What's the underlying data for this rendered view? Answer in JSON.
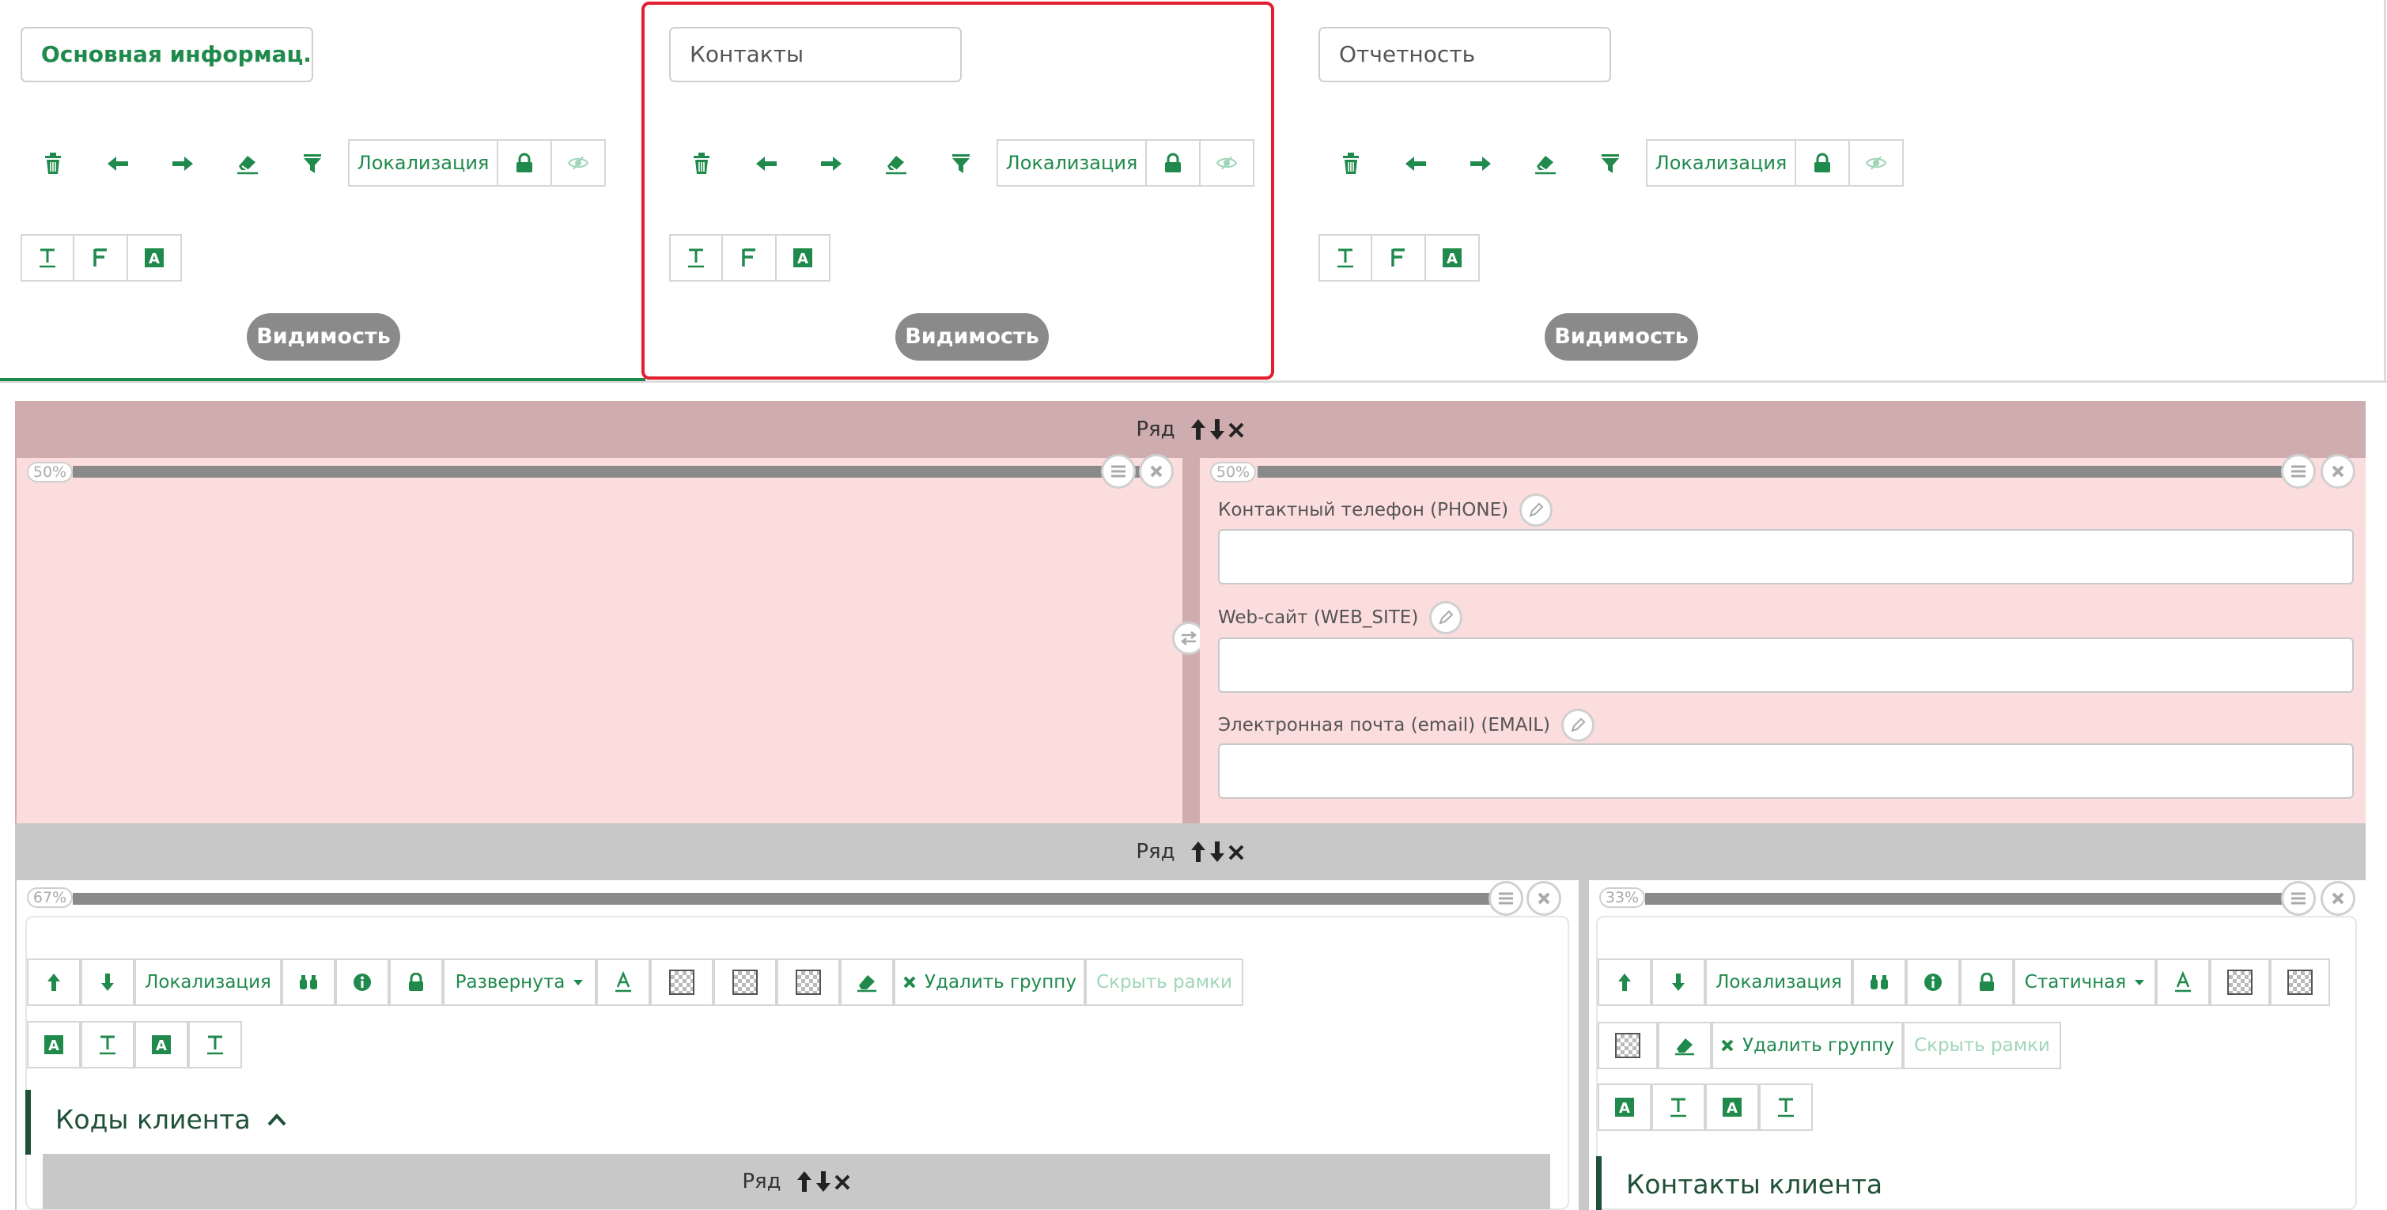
{
  "tabs": [
    {
      "name": "Основная информац...",
      "localization": "Локализация",
      "visibility": "Видимость"
    },
    {
      "name": "Контакты",
      "localization": "Локализация",
      "visibility": "Видимость"
    },
    {
      "name": "Отчетность",
      "localization": "Локализация",
      "visibility": "Видимость"
    }
  ],
  "row_label": "Ряд",
  "colors": {
    "accent": "#1f8a4c",
    "highlight": "#e0202e",
    "row_pink": "#cfacae",
    "col_pink": "#fcdddd",
    "row_gray": "#c8c8c8"
  },
  "row1": {
    "left_col": {
      "percent": "50%"
    },
    "right_col": {
      "percent": "50%",
      "fields": [
        {
          "label": "Контактный телефон (PHONE)",
          "value": ""
        },
        {
          "label": "Web-сайт (WEB_SITE)",
          "value": ""
        },
        {
          "label": "Электронная почта (email) (EMAIL)",
          "value": ""
        }
      ]
    }
  },
  "row2": {
    "left_col": {
      "percent": "67%",
      "localization": "Локализация",
      "state": "Развернута",
      "delete_group": "Удалить группу",
      "hide_frames": "Скрыть рамки",
      "group_title": "Коды клиента",
      "inner_row_label": "Ряд"
    },
    "right_col": {
      "percent": "33%",
      "localization": "Локализация",
      "state": "Статичная",
      "delete_group": "Удалить группу",
      "hide_frames": "Скрыть рамки",
      "group_title": "Контакты клиента"
    }
  }
}
